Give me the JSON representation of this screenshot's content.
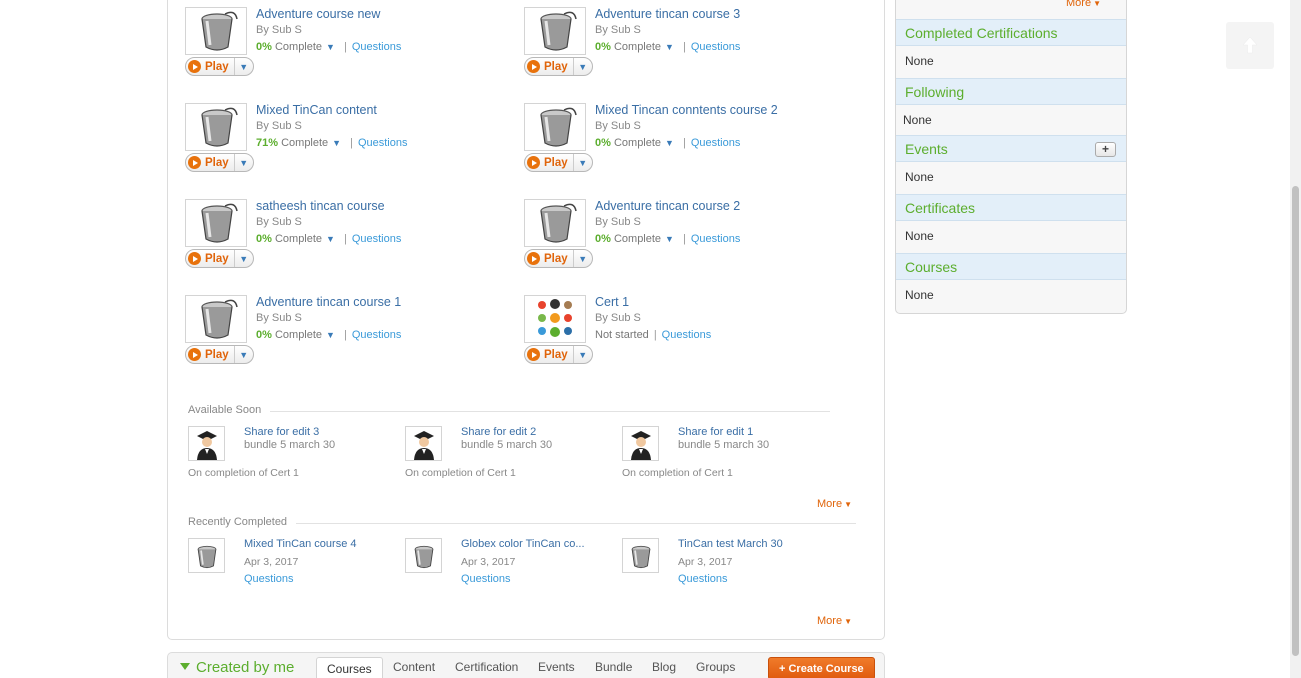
{
  "courses": [
    {
      "title": "Adventure course new",
      "by": "By Sub S",
      "pct": "0%",
      "status": "Complete",
      "questions": "Questions",
      "play": "Play",
      "icon": "bucket"
    },
    {
      "title": "Adventure tincan course 3",
      "by": "By Sub S",
      "pct": "0%",
      "status": "Complete",
      "questions": "Questions",
      "play": "Play",
      "icon": "bucket"
    },
    {
      "title": "Mixed TinCan content",
      "by": "By Sub S",
      "pct": "71%",
      "status": "Complete",
      "questions": "Questions",
      "play": "Play",
      "icon": "bucket"
    },
    {
      "title": "Mixed Tincan conntents course 2",
      "by": "By Sub S",
      "pct": "0%",
      "status": "Complete",
      "questions": "Questions",
      "play": "Play",
      "icon": "bucket"
    },
    {
      "title": "satheesh tincan course",
      "by": "By Sub S",
      "pct": "0%",
      "status": "Complete",
      "questions": "Questions",
      "play": "Play",
      "icon": "bucket"
    },
    {
      "title": "Adventure tincan course 2",
      "by": "By Sub S",
      "pct": "0%",
      "status": "Complete",
      "questions": "Questions",
      "play": "Play",
      "icon": "bucket"
    },
    {
      "title": "Adventure tincan course 1",
      "by": "By Sub S",
      "pct": "0%",
      "status": "Complete",
      "questions": "Questions",
      "play": "Play",
      "icon": "bucket"
    },
    {
      "title": "Cert 1",
      "by": "By Sub S",
      "pct": "",
      "status": "Not started",
      "questions": "Questions",
      "play": "Play",
      "icon": "certificate"
    }
  ],
  "available_soon": {
    "label": "Available Soon",
    "items": [
      {
        "title": "Share for edit 3",
        "subtitle": "bundle 5 march 30",
        "footer": "On completion of Cert 1"
      },
      {
        "title": "Share for edit 2",
        "subtitle": "bundle 5 march 30",
        "footer": "On completion of Cert 1"
      },
      {
        "title": "Share for edit 1",
        "subtitle": "bundle 5 march 30",
        "footer": "On completion of Cert 1"
      }
    ],
    "more": "More"
  },
  "recently_completed": {
    "label": "Recently Completed",
    "items": [
      {
        "title": "Mixed TinCan course 4",
        "date": "Apr 3, 2017",
        "questions": "Questions"
      },
      {
        "title": "Globex color TinCan co...",
        "date": "Apr 3, 2017",
        "questions": "Questions"
      },
      {
        "title": "TinCan test March 30",
        "date": "Apr 3, 2017",
        "questions": "Questions"
      }
    ],
    "more": "More"
  },
  "created_by_me": {
    "title": "Created by me",
    "tabs": [
      "Courses",
      "Content",
      "Certification",
      "Events",
      "Bundle",
      "Blog",
      "Groups"
    ],
    "active_tab": "Courses",
    "create_button": "+ Create Course"
  },
  "sidebar": {
    "more": "More",
    "sections": [
      {
        "title": "Completed Certifications",
        "value": "None"
      },
      {
        "title": "Following",
        "value": "None"
      },
      {
        "title": "Events",
        "value": "None",
        "has_add": true,
        "add_label": "+"
      },
      {
        "title": "Certificates",
        "value": "None"
      },
      {
        "title": "Courses",
        "value": "None"
      }
    ]
  },
  "colors": {
    "accent_orange": "#e0640a",
    "green": "#5cae2e",
    "link_blue": "#3a6ea5",
    "header_blue": "#e3eff9"
  }
}
